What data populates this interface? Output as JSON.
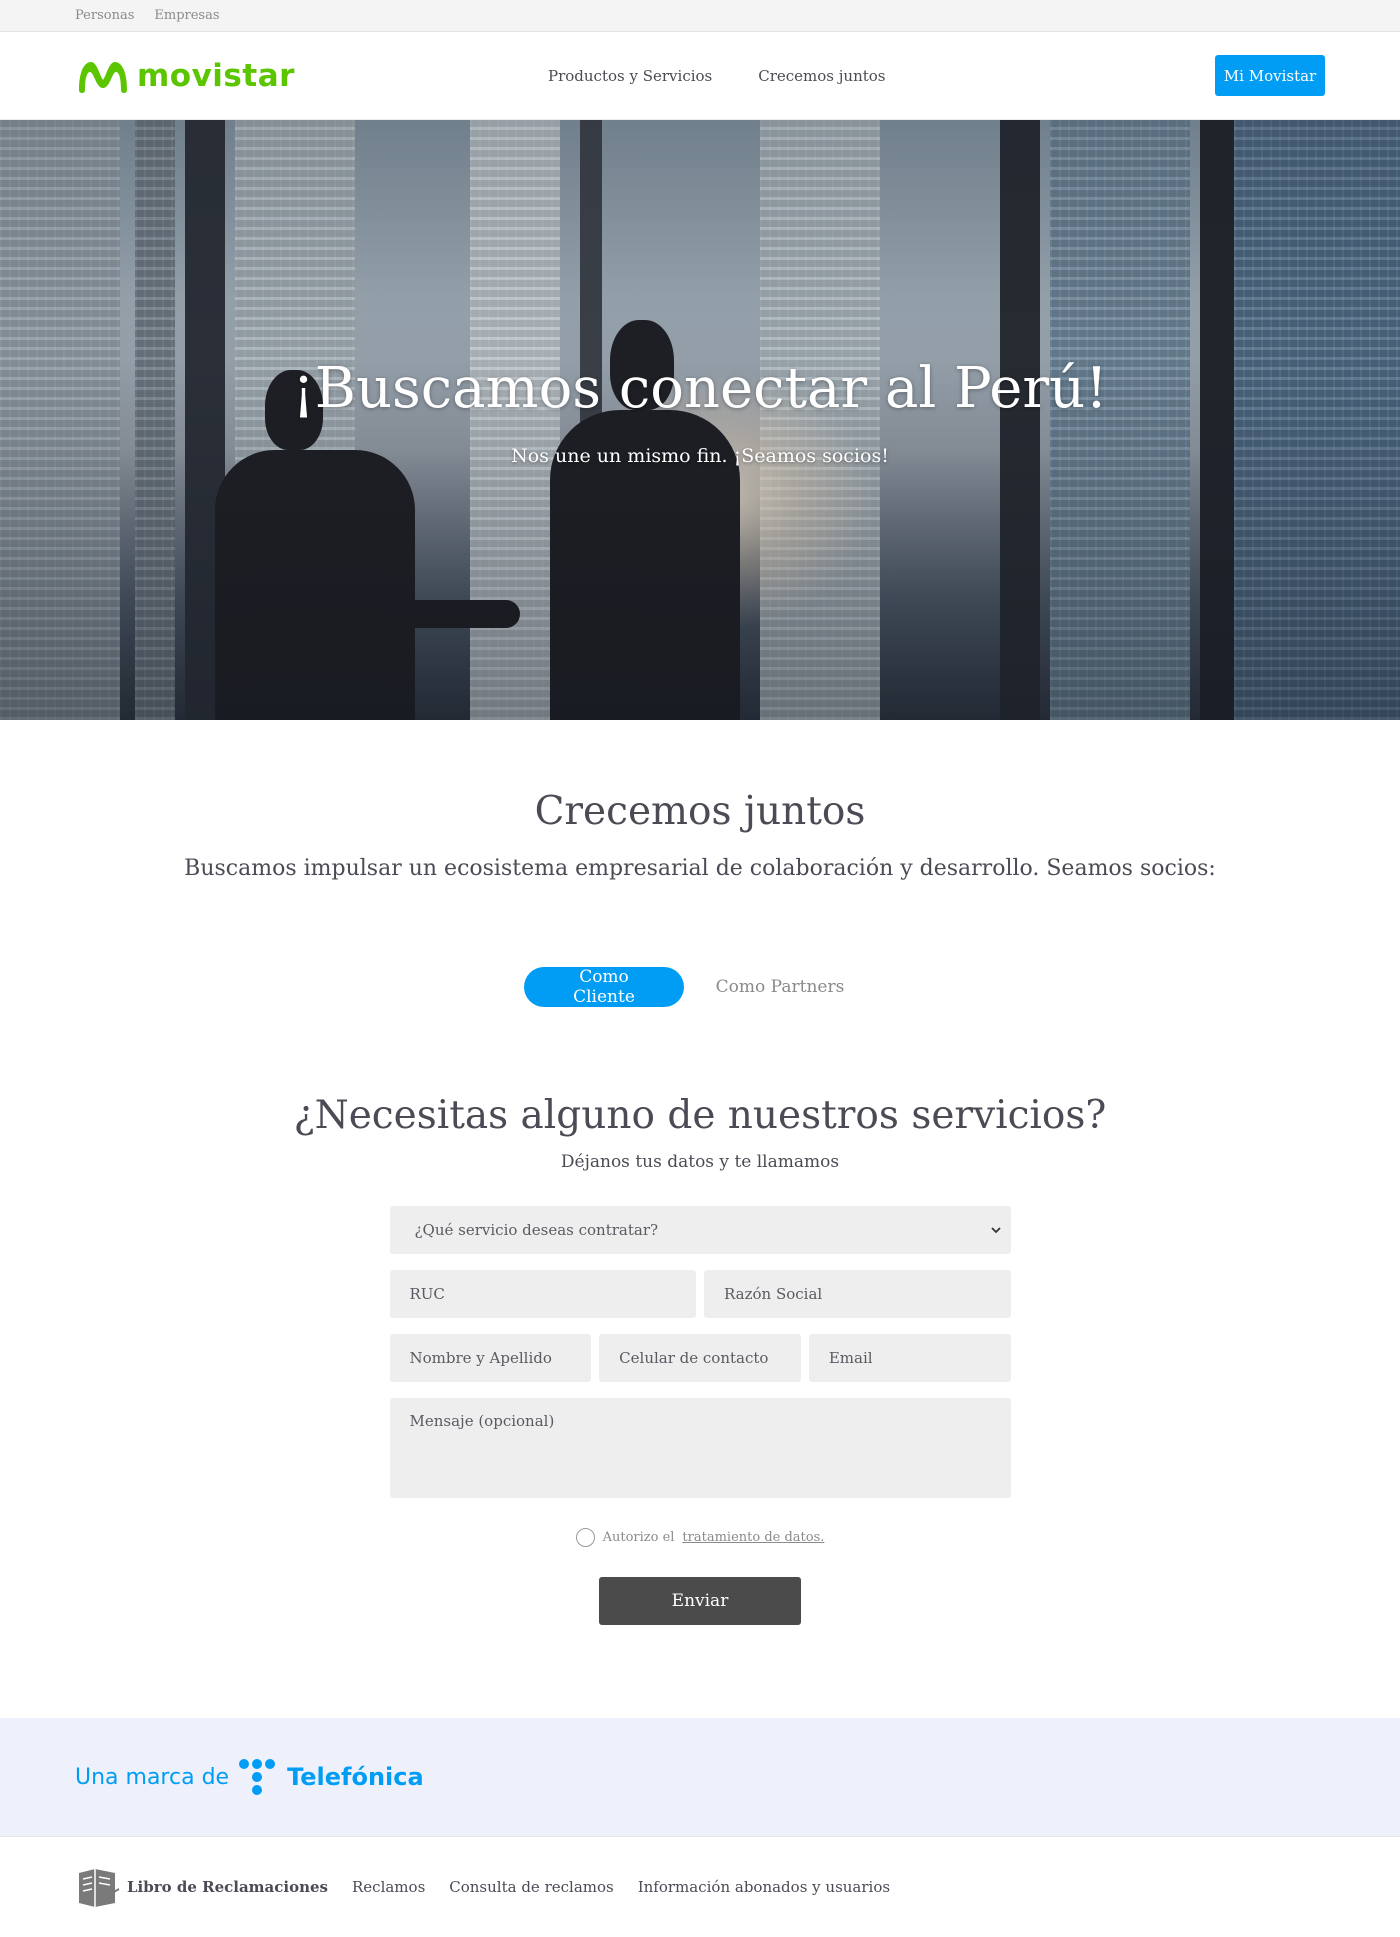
{
  "topbar": {
    "personas": "Personas",
    "empresas": "Empresas"
  },
  "header": {
    "brand": "movistar",
    "nav": [
      "Productos y Servicios",
      "Crecemos juntos"
    ],
    "mi_movistar": "Mi Movistar"
  },
  "hero": {
    "title": "¡Buscamos conectar al Perú!",
    "subtitle": "Nos une un mismo fin. ¡Seamos socios!"
  },
  "section": {
    "title": "Crecemos juntos",
    "description": "Buscamos impulsar un ecosistema empresarial de colaboración y desarrollo. Seamos socios:",
    "tabs": [
      "Como Cliente",
      "Como Partners"
    ]
  },
  "form": {
    "title": "¿Necesitas alguno de nuestros servicios?",
    "subtitle": "Déjanos tus datos y te llamamos",
    "select_placeholder": "¿Qué servicio deseas contratar?",
    "ruc": "RUC",
    "razon_social": "Razón Social",
    "nombre": "Nombre y Apellido",
    "celular": "Celular de contacto",
    "email": "Email",
    "mensaje": "Mensaje (opcional)",
    "consent_prefix": "Autorizo el",
    "consent_link": "tratamiento de datos.",
    "submit": "Enviar"
  },
  "brandband": {
    "prefix": "Una marca de",
    "name": "Telefónica"
  },
  "footer": {
    "libro": "Libro de Reclamaciones",
    "links": [
      "Reclamos",
      "Consulta de reclamos",
      "Información abonados y usuarios"
    ]
  },
  "colors": {
    "accent": "#019df4",
    "brand_green": "#5bc500",
    "button_dark": "#4b4b4b"
  }
}
